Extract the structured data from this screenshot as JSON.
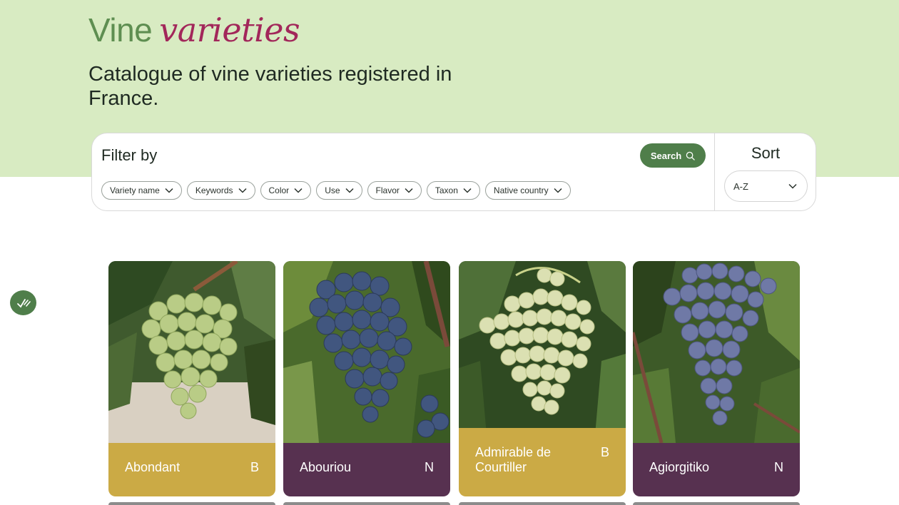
{
  "hero": {
    "title_main": "Vine",
    "title_accent": "varieties",
    "subtitle": "Catalogue of vine varieties registered in France."
  },
  "filter": {
    "heading": "Filter by",
    "search_label": "Search",
    "chips": [
      "Variety name",
      "Keywords",
      "Color",
      "Use",
      "Flavor",
      "Taxon",
      "Native country"
    ]
  },
  "sort": {
    "label": "Sort",
    "selected": "A-Z"
  },
  "cards": [
    {
      "name": "Abondant",
      "color": "B"
    },
    {
      "name": "Abouriou",
      "color": "N"
    },
    {
      "name": "Admirable de Courtiller",
      "color": "B"
    },
    {
      "name": "Agiorgitiko",
      "color": "N"
    }
  ],
  "colors": {
    "hero_bg": "#d8ebc2",
    "title_green": "#5e8e51",
    "accent_magenta": "#a2275a",
    "button_green": "#4f7e4a",
    "white_variety_gold": "#cbaa45",
    "black_variety_plum": "#573150"
  }
}
